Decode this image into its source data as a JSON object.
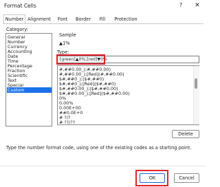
{
  "window": {
    "title": "Format Cells",
    "help_glyph": "?",
    "close_glyph": "✕"
  },
  "tabs": [
    "Number",
    "Alignment",
    "Font",
    "Border",
    "Fill",
    "Protection"
  ],
  "category": {
    "label": "Category:",
    "items": [
      "General",
      "Number",
      "Currency",
      "Accounting",
      "Date",
      "Time",
      "Percentage",
      "Fraction",
      "Scientific",
      "Text",
      "Special",
      "Custom"
    ],
    "selected": "Custom"
  },
  "sample": {
    "label": "Sample",
    "value": "▲1%"
  },
  "type": {
    "label": "Type:",
    "value": "[green]▲0%;[red]▼0%",
    "list": [
      "#,##0.00_);#,##0.00)",
      "#,##0.00_);[Red](#,##0.00)",
      "$#,##0_);($#,##0)",
      "$#,##0_);[Red]($#,##0)",
      "$#,##0.00_);($#,##0.00)",
      "$#,##0.00_);[Red]($#,##0.00)",
      "0%",
      "0.00%",
      "0.00E+00",
      "##0.0E+0",
      "# ?/?",
      "# ??/??"
    ]
  },
  "buttons": {
    "delete": "Delete",
    "ok": "OK",
    "cancel": "Cancel"
  },
  "hint": "Type the number format code, using one of the existing codes as a starting point."
}
